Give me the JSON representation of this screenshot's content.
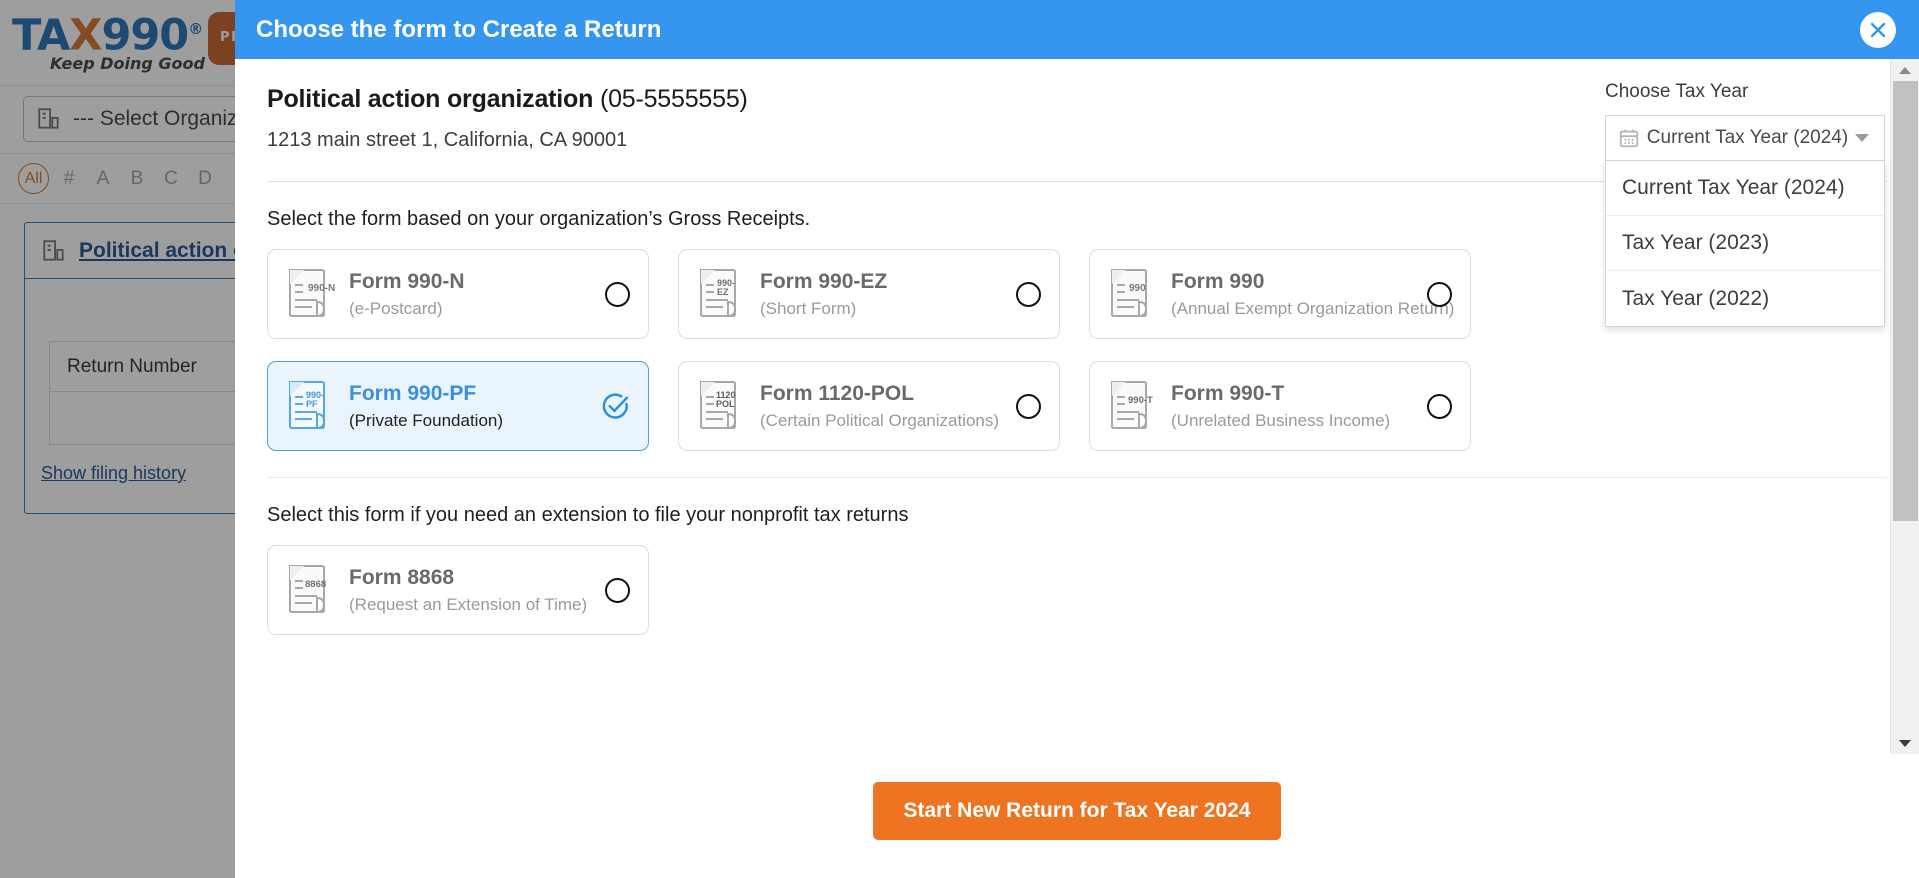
{
  "background": {
    "logo": {
      "text_left": "TA",
      "text_x": "X",
      "text_right": "990",
      "registered": "®",
      "badge": "PRO",
      "tagline": "Keep Doing Good"
    },
    "org_select": {
      "icon": "building-icon",
      "value": "--- Select Organizatio."
    },
    "alpha_filter": {
      "all_label": "All",
      "letters": [
        "#",
        "A",
        "B",
        "C",
        "D"
      ]
    },
    "org_card": {
      "icon": "building-icon",
      "name": "Political action or",
      "table_header": "Return Number",
      "history_link": "Show filing history"
    }
  },
  "modal": {
    "title": "Choose the form to Create a Return",
    "close_icon": "close-icon",
    "organization": {
      "name": "Political action organization",
      "ein": "(05-5555555)",
      "address": "1213 main street 1, California, CA 90001"
    },
    "tax_year": {
      "label": "Choose Tax Year",
      "icon": "calendar-icon",
      "selected": "Current Tax Year (2024)",
      "caret_icon": "chevron-down-icon",
      "open": true,
      "options": [
        "Current Tax Year (2024)",
        "Tax Year (2023)",
        "Tax Year (2022)"
      ]
    },
    "gross_receipts_section": {
      "label": "Select the form based on your organization’s Gross Receipts.",
      "forms": [
        {
          "badge": "990-N",
          "title": "Form 990-N",
          "subtitle": "(e-Postcard)",
          "selected": false,
          "radio_icon": "radio-unselected-icon"
        },
        {
          "badge": "990-EZ",
          "title": "Form 990-EZ",
          "subtitle": "(Short Form)",
          "selected": false,
          "radio_icon": "radio-unselected-icon"
        },
        {
          "badge": "990",
          "title": "Form 990",
          "subtitle": "(Annual Exempt Organization Return)",
          "selected": false,
          "radio_icon": "radio-unselected-icon"
        },
        {
          "badge": "990-PF",
          "title": "Form 990-PF",
          "subtitle": "(Private Foundation)",
          "selected": true,
          "radio_icon": "check-circle-icon"
        },
        {
          "badge": "1120-POL",
          "title": "Form 1120-POL",
          "subtitle": "(Certain Political Organizations)",
          "selected": false,
          "radio_icon": "radio-unselected-icon"
        },
        {
          "badge": "990-T",
          "title": "Form 990-T",
          "subtitle": "(Unrelated Business Income)",
          "selected": false,
          "radio_icon": "radio-unselected-icon"
        }
      ]
    },
    "extension_section": {
      "label": "Select this form if you need an extension to file your nonprofit tax returns",
      "forms": [
        {
          "badge": "8868",
          "title": "Form 8868",
          "subtitle": "(Request an Extension of Time)",
          "selected": false,
          "radio_icon": "radio-unselected-icon"
        }
      ]
    },
    "footer": {
      "start_button": "Start New Return for Tax Year 2024"
    },
    "scrollbar": {
      "up_icon": "scroll-up-arrow-icon",
      "down_icon": "scroll-down-arrow-icon"
    }
  },
  "colors": {
    "header_blue": "#3596f0",
    "accent_orange": "#ee7421",
    "brand_blue": "#1565b0",
    "brand_orange": "#c0561c",
    "selected_card_bg": "#eaf4fd",
    "selected_card_border": "#4a9fe8",
    "link_blue": "#12448a"
  }
}
